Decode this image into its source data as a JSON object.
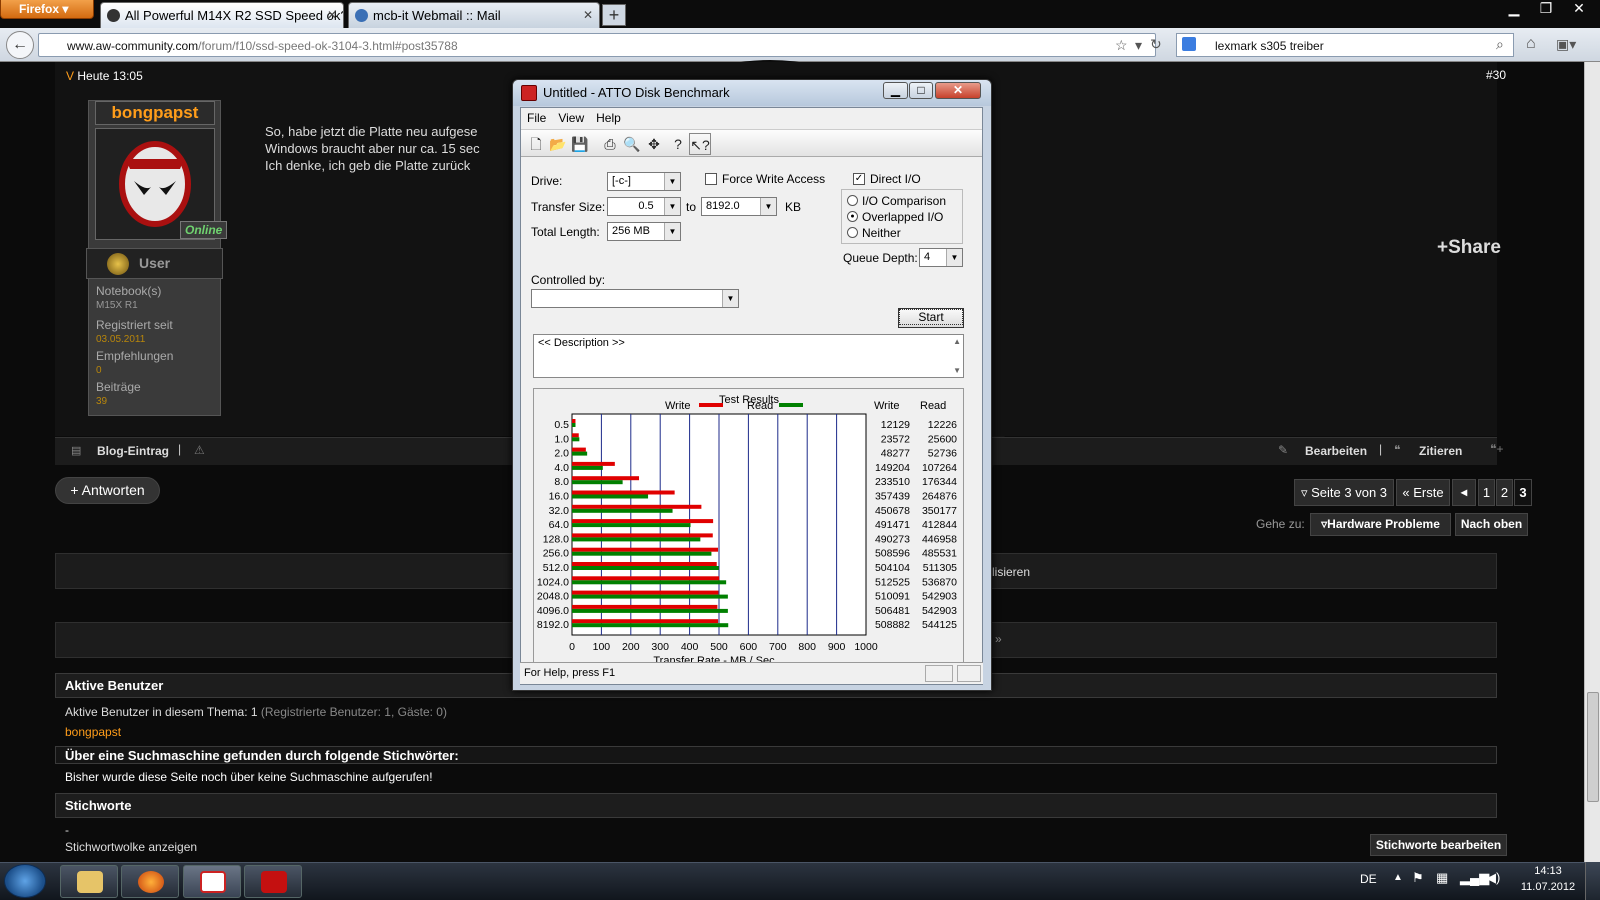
{
  "firefox_menu": "Firefox",
  "tabs": [
    {
      "label": "All Powerful M14X R2 SSD Speed ok? ..."
    },
    {
      "label": "mcb-it Webmail :: Mail"
    }
  ],
  "url": {
    "host": "www.aw-community.com",
    "path": "/forum/f10/ssd-speed-ok-3104-3.html#post35788"
  },
  "search": {
    "value": "lexmark s305 treiber"
  },
  "post": {
    "time": "Heute 13:05",
    "number": "#30",
    "author": "bongpapst",
    "status": "Online",
    "rank": "User",
    "lines": [
      "So, habe jetzt die Platte neu aufgese",
      "Windows braucht aber nur ca. 15 sec",
      "Ich denke, ich geb die Platte zurück"
    ],
    "fields": [
      {
        "label": "Notebook(s)",
        "value": "M15X R1"
      },
      {
        "label": "Registriert seit",
        "value": "03.05.2011"
      },
      {
        "label": "Empfehlungen",
        "value": "0"
      },
      {
        "label": "Beiträge",
        "value": "39"
      }
    ],
    "share": "+Share",
    "actions": {
      "blog": "Blog-Eintrag",
      "edit": "Bearbeiten",
      "quote": "Zitieren"
    }
  },
  "reply_button": "+ Antworten",
  "pagination": {
    "label": "Seite 3 von 3",
    "first": "Erste",
    "pages": [
      "1",
      "2",
      "3"
    ],
    "current": "3"
  },
  "goto": {
    "label": "Gehe zu:",
    "forum": "Hardware Probleme",
    "top": "Nach oben"
  },
  "hidden_fragment": "lisieren",
  "active_users": {
    "title": "Aktive Benutzer",
    "line": "Aktive Benutzer in diesem Thema: 1",
    "detail": "(Registrierte Benutzer: 1, Gäste: 0)",
    "user": "bongpapst"
  },
  "search_terms": {
    "title": "Über eine Suchmaschine gefunden durch folgende Stichwörter:",
    "text": "Bisher wurde diese Seite noch über keine Suchmaschine aufgerufen!"
  },
  "tags": {
    "title": "Stichworte",
    "dash": "-",
    "cloud": "Stichwortwolke anzeigen",
    "edit": "Stichworte bearbeiten"
  },
  "atto": {
    "title": "Untitled - ATTO Disk Benchmark",
    "menu": [
      "File",
      "View",
      "Help"
    ],
    "drive_label": "Drive:",
    "drive": "[-c-]",
    "force_write": "Force Write Access",
    "direct_io": "Direct I/O",
    "transfer_label": "Transfer Size:",
    "transfer_from": "0.5",
    "to": "to",
    "transfer_to": "8192.0",
    "kb": "KB",
    "length_label": "Total Length:",
    "length": "256 MB",
    "io_comparison": "I/O Comparison",
    "overlapped": "Overlapped I/O",
    "neither": "Neither",
    "queue_label": "Queue Depth:",
    "queue": "4",
    "controlled_label": "Controlled by:",
    "start": "Start",
    "description": "<< Description >>",
    "results_title": "Test Results",
    "write_legend": "Write",
    "read_legend": "Read",
    "col_write": "Write",
    "col_read": "Read",
    "status": "For Help, press F1"
  },
  "chart_data": {
    "type": "bar",
    "title": "Test Results",
    "xlabel": "Transfer Rate - MB / Sec",
    "ylabel": "",
    "xlim": [
      0,
      1000
    ],
    "xticks": [
      "0",
      "100",
      "200",
      "300",
      "400",
      "500",
      "600",
      "700",
      "800",
      "900",
      "1000"
    ],
    "categories": [
      "0.5",
      "1.0",
      "2.0",
      "4.0",
      "8.0",
      "16.0",
      "32.0",
      "64.0",
      "128.0",
      "256.0",
      "512.0",
      "1024.0",
      "2048.0",
      "4096.0",
      "8192.0"
    ],
    "series": [
      {
        "name": "Write",
        "color": "#e00000",
        "values_kb": [
          12129,
          23572,
          48277,
          149204,
          233510,
          357439,
          450678,
          491471,
          490273,
          508596,
          504104,
          512525,
          510091,
          506481,
          508882
        ],
        "values_mb": [
          11.8,
          23.0,
          47.1,
          145.7,
          228.0,
          349.1,
          440.1,
          480.0,
          478.8,
          496.7,
          492.3,
          500.5,
          498.1,
          494.6,
          496.9
        ]
      },
      {
        "name": "Read",
        "color": "#008000",
        "values_kb": [
          12226,
          25600,
          52736,
          107264,
          176344,
          264876,
          350177,
          412844,
          446958,
          485531,
          511305,
          536870,
          542903,
          542903,
          544125
        ],
        "values_mb": [
          11.9,
          25.0,
          51.5,
          104.8,
          172.2,
          258.7,
          342.0,
          403.2,
          436.5,
          474.2,
          499.3,
          524.3,
          530.2,
          530.2,
          531.4
        ]
      }
    ]
  },
  "taskbar": {
    "lang": "DE",
    "time": "14:13",
    "date": "11.07.2012"
  }
}
